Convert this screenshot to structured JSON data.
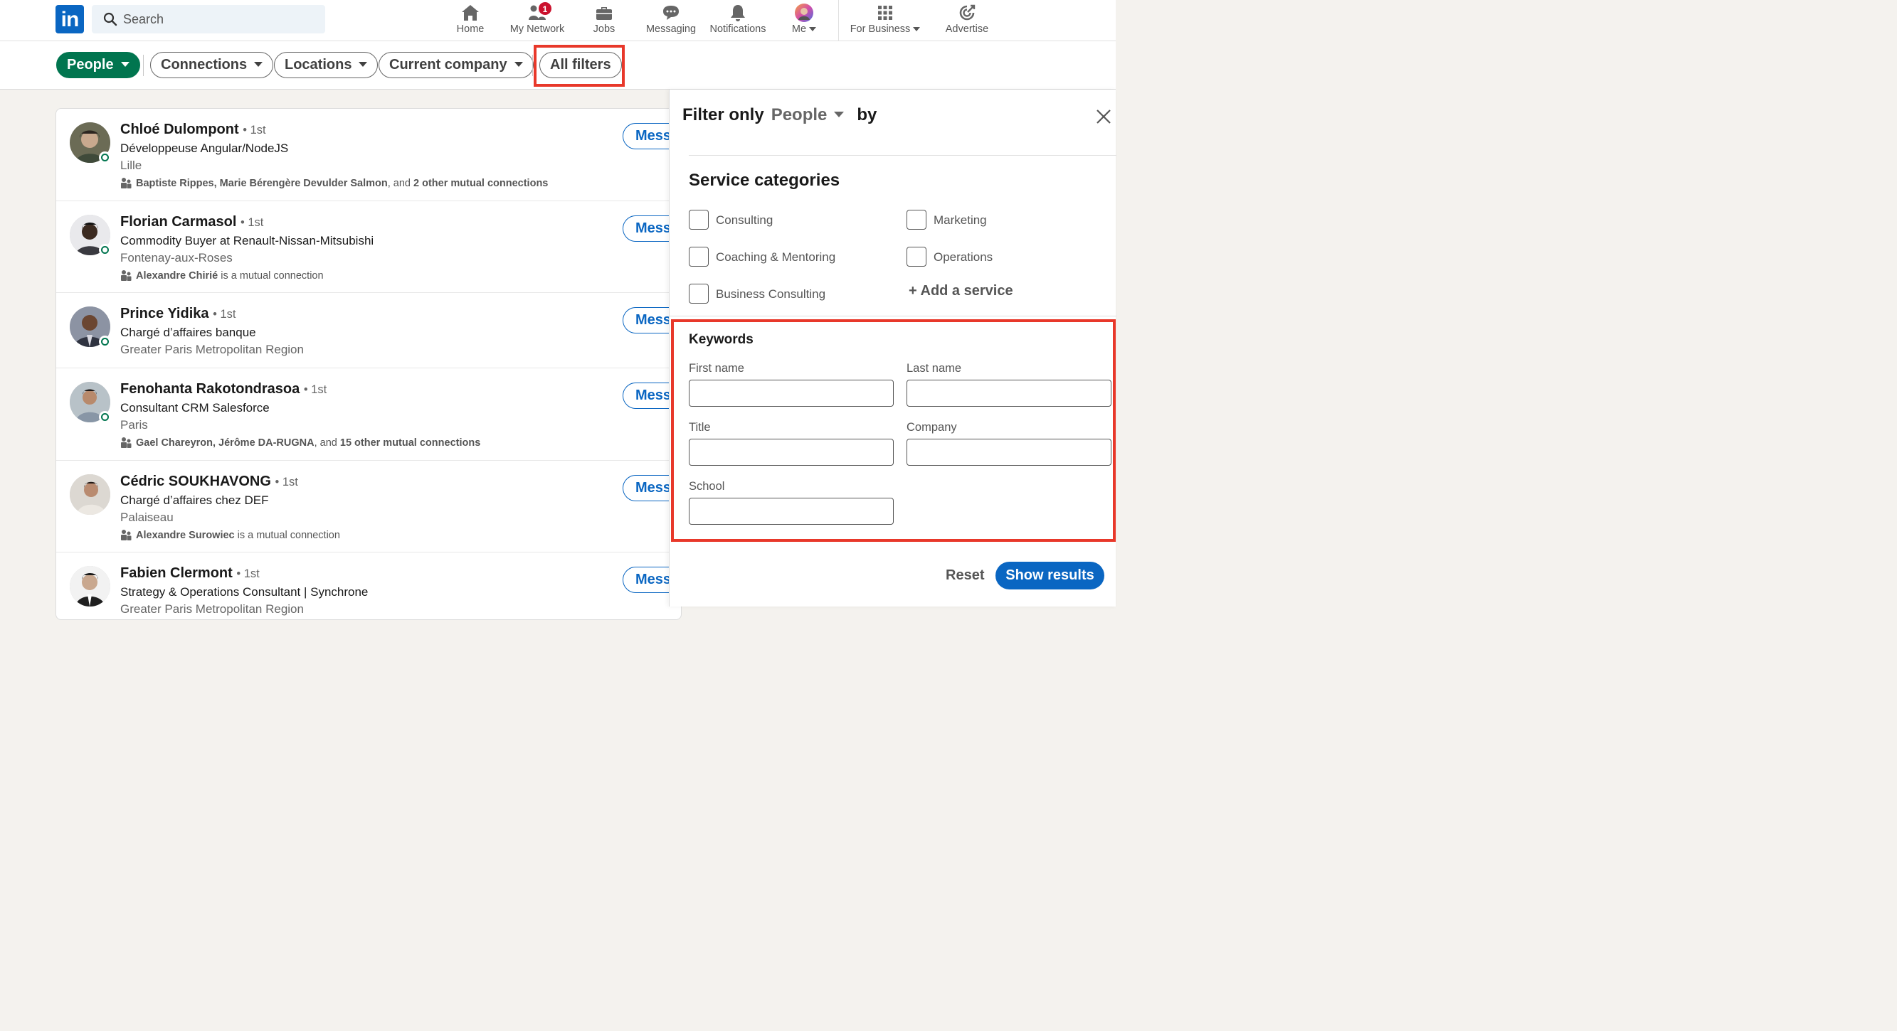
{
  "nav": {
    "logo_text": "in",
    "search_placeholder": "Search",
    "items": [
      {
        "label": "Home",
        "icon": "home-icon"
      },
      {
        "label": "My Network",
        "icon": "network-icon",
        "badge": "1"
      },
      {
        "label": "Jobs",
        "icon": "briefcase-icon"
      },
      {
        "label": "Messaging",
        "icon": "messaging-icon"
      },
      {
        "label": "Notifications",
        "icon": "bell-icon"
      },
      {
        "label": "Me",
        "icon": "avatar"
      },
      {
        "label": "For Business",
        "icon": "grid-icon"
      },
      {
        "label": "Advertise",
        "icon": "advertise-icon"
      }
    ]
  },
  "filters": {
    "people": "People",
    "connections": "Connections",
    "locations": "Locations",
    "current_company": "Current company",
    "all_filters": "All filters"
  },
  "results": [
    {
      "name": "Chloé Dulompont",
      "degree": "• 1st",
      "title": "Développeuse Angular/NodeJS",
      "location": "Lille",
      "mutual_names": "Baptiste Rippes, Marie Bérengère Devulder Salmon",
      "mutual_mid": ", and ",
      "mutual_count": "2 other mutual connections",
      "action": "Mess"
    },
    {
      "name": "Florian Carmasol",
      "degree": "• 1st",
      "title": "Commodity Buyer at Renault-Nissan-Mitsubishi",
      "location": "Fontenay-aux-Roses",
      "mutual_names": "Alexandre Chirié",
      "mutual_mid": " is a mutual connection",
      "mutual_count": "",
      "action": "Mess"
    },
    {
      "name": "Prince Yidika",
      "degree": "• 1st",
      "title": "Chargé d’affaires banque",
      "location": "Greater Paris Metropolitan Region",
      "action": "Mess"
    },
    {
      "name": "Fenohanta Rakotondrasoa",
      "degree": "• 1st",
      "title": "Consultant CRM Salesforce",
      "location": "Paris",
      "mutual_names": "Gael Chareyron, Jérôme DA-RUGNA",
      "mutual_mid": ", and ",
      "mutual_count": "15 other mutual connections",
      "action": "Mess"
    },
    {
      "name": "Cédric SOUKHAVONG",
      "degree": "• 1st",
      "title": "Chargé d’affaires chez DEF",
      "location": "Palaiseau",
      "mutual_names": "Alexandre Surowiec",
      "mutual_mid": " is a mutual connection",
      "mutual_count": "",
      "action": "Mess"
    },
    {
      "name": "Fabien Clermont",
      "degree": "• 1st",
      "title": "Strategy & Operations Consultant | Synchrone",
      "location": "Greater Paris Metropolitan Region",
      "action": "Mess"
    }
  ],
  "panel": {
    "filter_only": "Filter only",
    "entity": "People",
    "by": "by",
    "service_title": "Service categories",
    "services": {
      "consulting": "Consulting",
      "marketing": "Marketing",
      "coaching": "Coaching & Mentoring",
      "operations": "Operations",
      "business_consulting": "Business Consulting"
    },
    "add_service": "+ Add a service",
    "keywords_title": "Keywords",
    "fields": {
      "first_name": "First name",
      "last_name": "Last name",
      "title": "Title",
      "company": "Company",
      "school": "School"
    },
    "reset": "Reset",
    "show_results": "Show results"
  },
  "colors": {
    "brand": "#0a66c2",
    "active_pill": "#01754f",
    "highlight": "#e8382a",
    "badge": "#cb112d"
  }
}
